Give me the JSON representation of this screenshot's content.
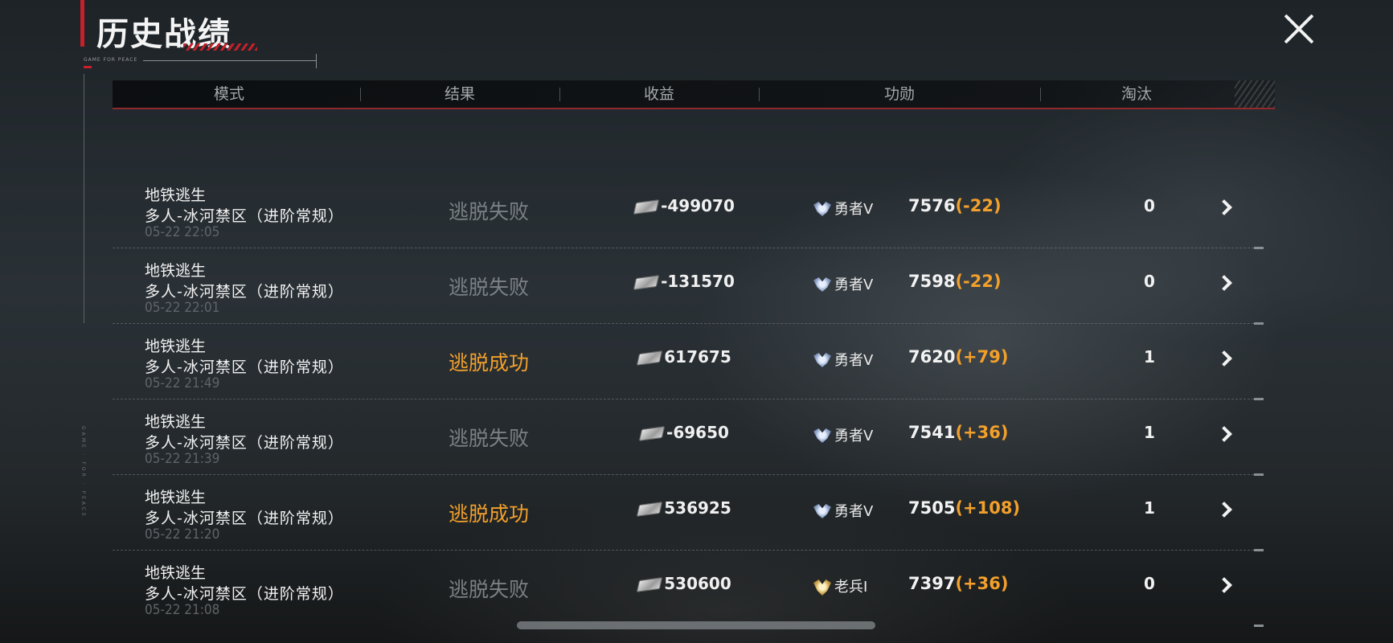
{
  "header": {
    "title": "历史战绩",
    "deco_text": "GAME FOR PEACE",
    "side_text": "GAME · FOR · PEACE"
  },
  "columns": {
    "mode": "模式",
    "result": "结果",
    "income": "收益",
    "merit": "功勋",
    "eliminations": "淘汰"
  },
  "rows": [
    {
      "mode_name": "地铁逃生",
      "map": "多人-冰河禁区（进阶常规）",
      "time": "05-22 22:05",
      "result": "逃脱失败",
      "result_type": "fail",
      "income": "-499070",
      "rank": "勇者Ⅴ",
      "rank_icon": "silver-rank-icon",
      "merit": "7576",
      "merit_delta": "(-22)",
      "eliminations": "0"
    },
    {
      "mode_name": "地铁逃生",
      "map": "多人-冰河禁区（进阶常规）",
      "time": "05-22 22:01",
      "result": "逃脱失败",
      "result_type": "fail",
      "income": "-131570",
      "rank": "勇者Ⅴ",
      "rank_icon": "silver-rank-icon",
      "merit": "7598",
      "merit_delta": "(-22)",
      "eliminations": "0"
    },
    {
      "mode_name": "地铁逃生",
      "map": "多人-冰河禁区（进阶常规）",
      "time": "05-22 21:49",
      "result": "逃脱成功",
      "result_type": "success",
      "income": "617675",
      "rank": "勇者Ⅴ",
      "rank_icon": "silver-rank-icon",
      "merit": "7620",
      "merit_delta": "(+79)",
      "eliminations": "1"
    },
    {
      "mode_name": "地铁逃生",
      "map": "多人-冰河禁区（进阶常规）",
      "time": "05-22 21:39",
      "result": "逃脱失败",
      "result_type": "fail",
      "income": "-69650",
      "rank": "勇者Ⅴ",
      "rank_icon": "silver-rank-icon",
      "merit": "7541",
      "merit_delta": "(+36)",
      "eliminations": "1"
    },
    {
      "mode_name": "地铁逃生",
      "map": "多人-冰河禁区（进阶常规）",
      "time": "05-22 21:20",
      "result": "逃脱成功",
      "result_type": "success",
      "income": "536925",
      "rank": "勇者Ⅴ",
      "rank_icon": "silver-rank-icon",
      "merit": "7505",
      "merit_delta": "(+108)",
      "eliminations": "1"
    },
    {
      "mode_name": "地铁逃生",
      "map": "多人-冰河禁区（进阶常规）",
      "time": "05-22 21:08",
      "result": "逃脱失败",
      "result_type": "fail",
      "income": "530600",
      "rank": "老兵Ⅰ",
      "rank_icon": "gold-rank-icon",
      "merit": "7397",
      "merit_delta": "(+36)",
      "eliminations": "0"
    }
  ],
  "colors": {
    "accent_red": "#c8202a",
    "success_orange": "#f2a02b",
    "fail_gray": "#7b8084"
  }
}
